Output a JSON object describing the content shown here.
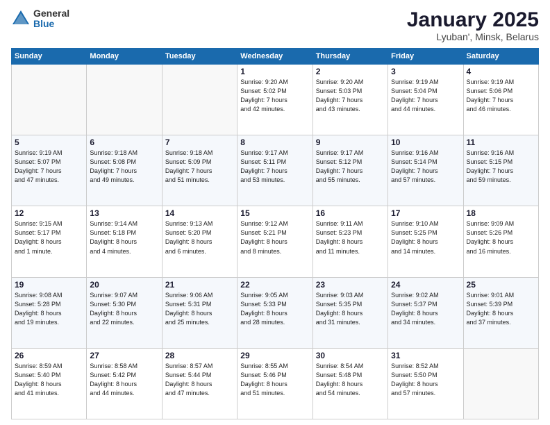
{
  "header": {
    "logo_general": "General",
    "logo_blue": "Blue",
    "month_year": "January 2025",
    "location": "Lyuban', Minsk, Belarus"
  },
  "days_of_week": [
    "Sunday",
    "Monday",
    "Tuesday",
    "Wednesday",
    "Thursday",
    "Friday",
    "Saturday"
  ],
  "weeks": [
    [
      {
        "num": "",
        "detail": ""
      },
      {
        "num": "",
        "detail": ""
      },
      {
        "num": "",
        "detail": ""
      },
      {
        "num": "1",
        "detail": "Sunrise: 9:20 AM\nSunset: 5:02 PM\nDaylight: 7 hours\nand 42 minutes."
      },
      {
        "num": "2",
        "detail": "Sunrise: 9:20 AM\nSunset: 5:03 PM\nDaylight: 7 hours\nand 43 minutes."
      },
      {
        "num": "3",
        "detail": "Sunrise: 9:19 AM\nSunset: 5:04 PM\nDaylight: 7 hours\nand 44 minutes."
      },
      {
        "num": "4",
        "detail": "Sunrise: 9:19 AM\nSunset: 5:06 PM\nDaylight: 7 hours\nand 46 minutes."
      }
    ],
    [
      {
        "num": "5",
        "detail": "Sunrise: 9:19 AM\nSunset: 5:07 PM\nDaylight: 7 hours\nand 47 minutes."
      },
      {
        "num": "6",
        "detail": "Sunrise: 9:18 AM\nSunset: 5:08 PM\nDaylight: 7 hours\nand 49 minutes."
      },
      {
        "num": "7",
        "detail": "Sunrise: 9:18 AM\nSunset: 5:09 PM\nDaylight: 7 hours\nand 51 minutes."
      },
      {
        "num": "8",
        "detail": "Sunrise: 9:17 AM\nSunset: 5:11 PM\nDaylight: 7 hours\nand 53 minutes."
      },
      {
        "num": "9",
        "detail": "Sunrise: 9:17 AM\nSunset: 5:12 PM\nDaylight: 7 hours\nand 55 minutes."
      },
      {
        "num": "10",
        "detail": "Sunrise: 9:16 AM\nSunset: 5:14 PM\nDaylight: 7 hours\nand 57 minutes."
      },
      {
        "num": "11",
        "detail": "Sunrise: 9:16 AM\nSunset: 5:15 PM\nDaylight: 7 hours\nand 59 minutes."
      }
    ],
    [
      {
        "num": "12",
        "detail": "Sunrise: 9:15 AM\nSunset: 5:17 PM\nDaylight: 8 hours\nand 1 minute."
      },
      {
        "num": "13",
        "detail": "Sunrise: 9:14 AM\nSunset: 5:18 PM\nDaylight: 8 hours\nand 4 minutes."
      },
      {
        "num": "14",
        "detail": "Sunrise: 9:13 AM\nSunset: 5:20 PM\nDaylight: 8 hours\nand 6 minutes."
      },
      {
        "num": "15",
        "detail": "Sunrise: 9:12 AM\nSunset: 5:21 PM\nDaylight: 8 hours\nand 8 minutes."
      },
      {
        "num": "16",
        "detail": "Sunrise: 9:11 AM\nSunset: 5:23 PM\nDaylight: 8 hours\nand 11 minutes."
      },
      {
        "num": "17",
        "detail": "Sunrise: 9:10 AM\nSunset: 5:25 PM\nDaylight: 8 hours\nand 14 minutes."
      },
      {
        "num": "18",
        "detail": "Sunrise: 9:09 AM\nSunset: 5:26 PM\nDaylight: 8 hours\nand 16 minutes."
      }
    ],
    [
      {
        "num": "19",
        "detail": "Sunrise: 9:08 AM\nSunset: 5:28 PM\nDaylight: 8 hours\nand 19 minutes."
      },
      {
        "num": "20",
        "detail": "Sunrise: 9:07 AM\nSunset: 5:30 PM\nDaylight: 8 hours\nand 22 minutes."
      },
      {
        "num": "21",
        "detail": "Sunrise: 9:06 AM\nSunset: 5:31 PM\nDaylight: 8 hours\nand 25 minutes."
      },
      {
        "num": "22",
        "detail": "Sunrise: 9:05 AM\nSunset: 5:33 PM\nDaylight: 8 hours\nand 28 minutes."
      },
      {
        "num": "23",
        "detail": "Sunrise: 9:03 AM\nSunset: 5:35 PM\nDaylight: 8 hours\nand 31 minutes."
      },
      {
        "num": "24",
        "detail": "Sunrise: 9:02 AM\nSunset: 5:37 PM\nDaylight: 8 hours\nand 34 minutes."
      },
      {
        "num": "25",
        "detail": "Sunrise: 9:01 AM\nSunset: 5:39 PM\nDaylight: 8 hours\nand 37 minutes."
      }
    ],
    [
      {
        "num": "26",
        "detail": "Sunrise: 8:59 AM\nSunset: 5:40 PM\nDaylight: 8 hours\nand 41 minutes."
      },
      {
        "num": "27",
        "detail": "Sunrise: 8:58 AM\nSunset: 5:42 PM\nDaylight: 8 hours\nand 44 minutes."
      },
      {
        "num": "28",
        "detail": "Sunrise: 8:57 AM\nSunset: 5:44 PM\nDaylight: 8 hours\nand 47 minutes."
      },
      {
        "num": "29",
        "detail": "Sunrise: 8:55 AM\nSunset: 5:46 PM\nDaylight: 8 hours\nand 51 minutes."
      },
      {
        "num": "30",
        "detail": "Sunrise: 8:54 AM\nSunset: 5:48 PM\nDaylight: 8 hours\nand 54 minutes."
      },
      {
        "num": "31",
        "detail": "Sunrise: 8:52 AM\nSunset: 5:50 PM\nDaylight: 8 hours\nand 57 minutes."
      },
      {
        "num": "",
        "detail": ""
      }
    ]
  ]
}
